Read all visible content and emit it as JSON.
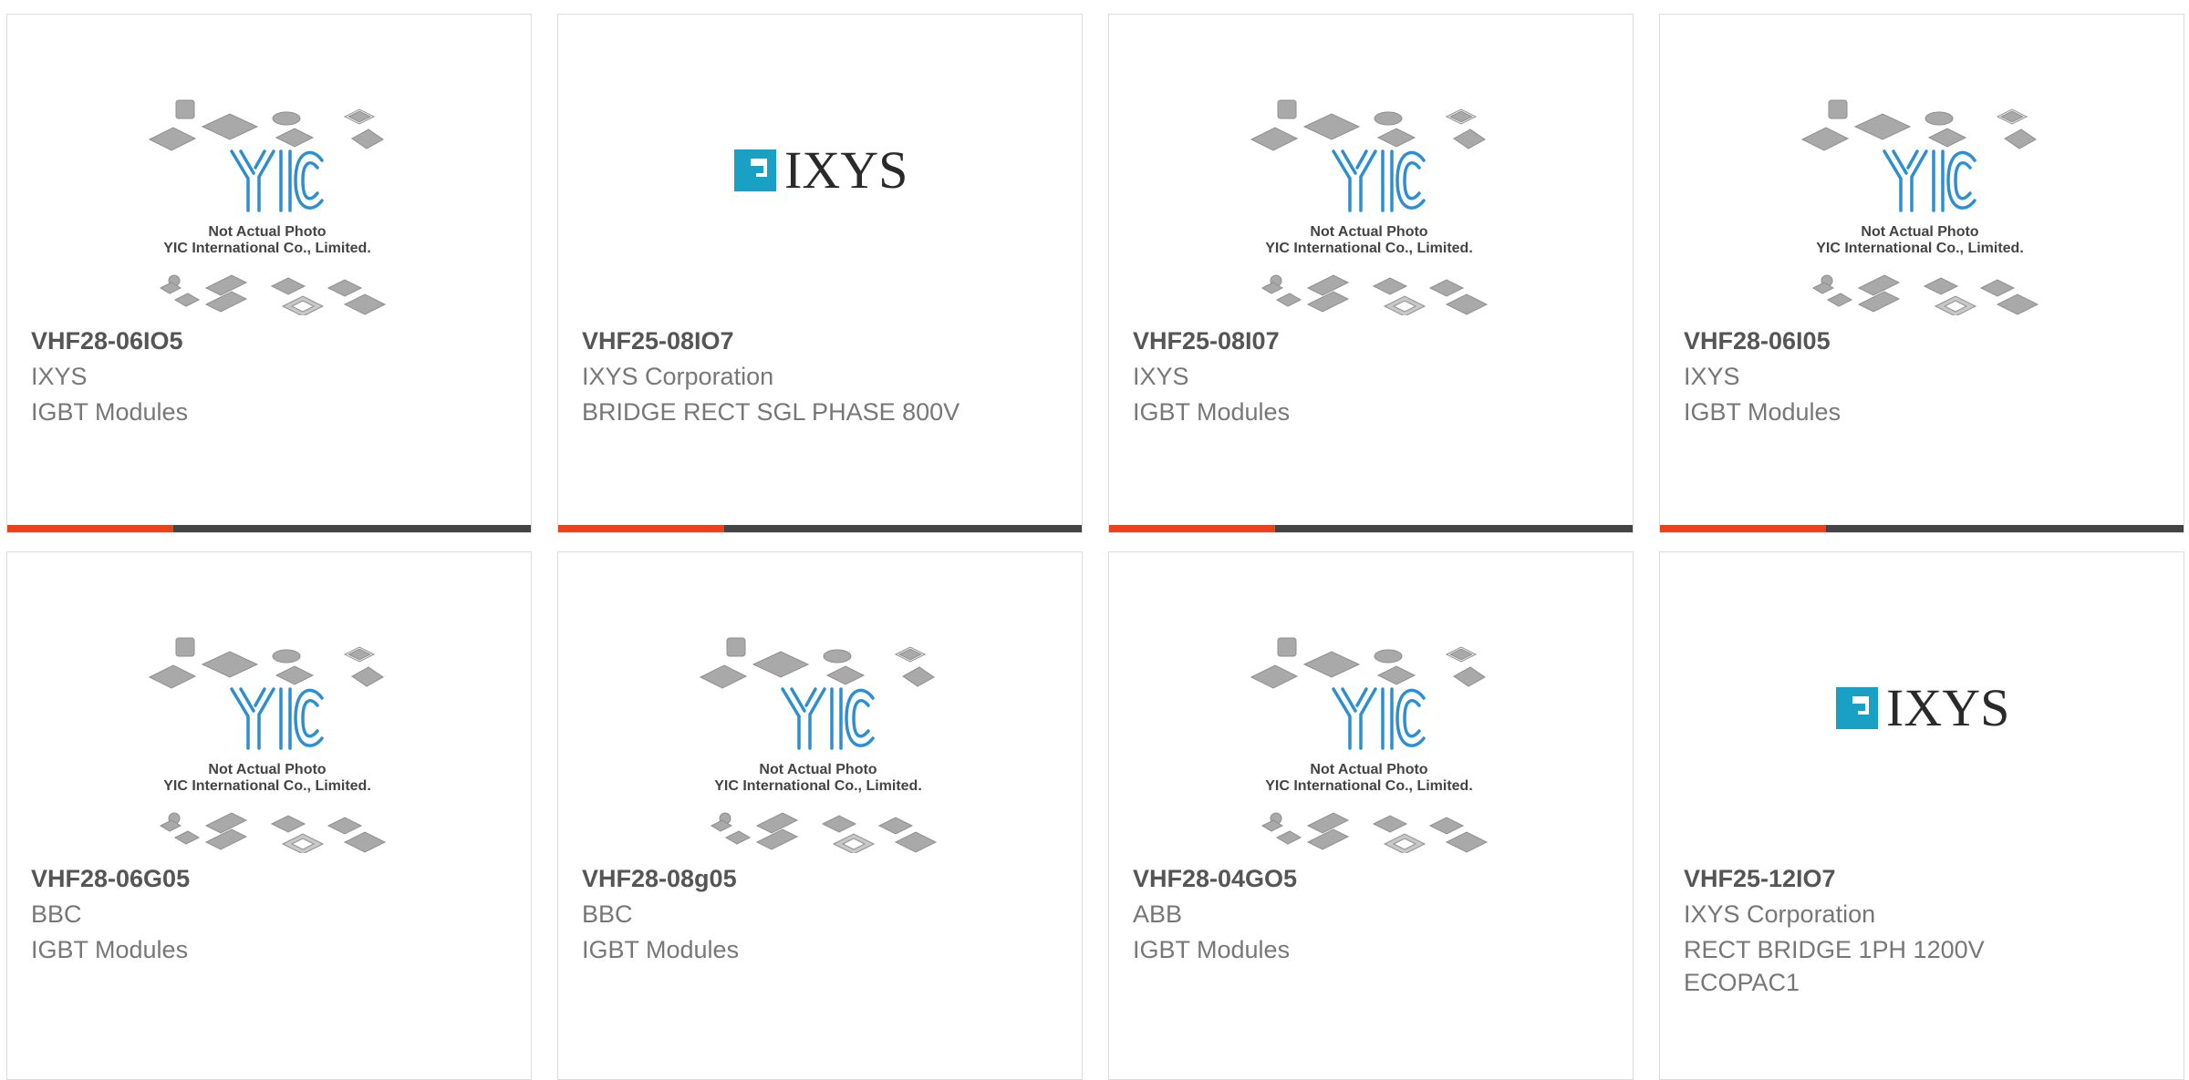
{
  "colors": {
    "accent": "#e8431b",
    "bar": "#444444",
    "ixys_logo_teal": "#1aa0c4",
    "yic_logo_blue": "#2d8fd0"
  },
  "placeholder": {
    "line1": "Not Actual Photo",
    "line2": "YIC International Co., Limited.",
    "logo_text": "YIC"
  },
  "ixys_logo": {
    "text": "IXYS"
  },
  "products": [
    {
      "part": "VHF28-06IO5",
      "maker": "IXYS",
      "desc": "IGBT Modules",
      "image": "yic-placeholder"
    },
    {
      "part": "VHF25-08IO7",
      "maker": "IXYS Corporation",
      "desc": "BRIDGE RECT SGL PHASE 800V",
      "image": "ixys-logo"
    },
    {
      "part": "VHF25-08I07",
      "maker": "IXYS",
      "desc": "IGBT Modules",
      "image": "yic-placeholder"
    },
    {
      "part": "VHF28-06I05",
      "maker": "IXYS",
      "desc": "IGBT Modules",
      "image": "yic-placeholder"
    },
    {
      "part": "VHF28-06G05",
      "maker": "BBC",
      "desc": "IGBT Modules",
      "image": "yic-placeholder"
    },
    {
      "part": "VHF28-08g05",
      "maker": "BBC",
      "desc": "IGBT Modules",
      "image": "yic-placeholder"
    },
    {
      "part": "VHF28-04GO5",
      "maker": "ABB",
      "desc": "IGBT Modules",
      "image": "yic-placeholder"
    },
    {
      "part": "VHF25-12IO7",
      "maker": "IXYS Corporation",
      "desc": "RECT BRIDGE 1PH 1200V ECOPAC1",
      "image": "ixys-logo"
    }
  ]
}
